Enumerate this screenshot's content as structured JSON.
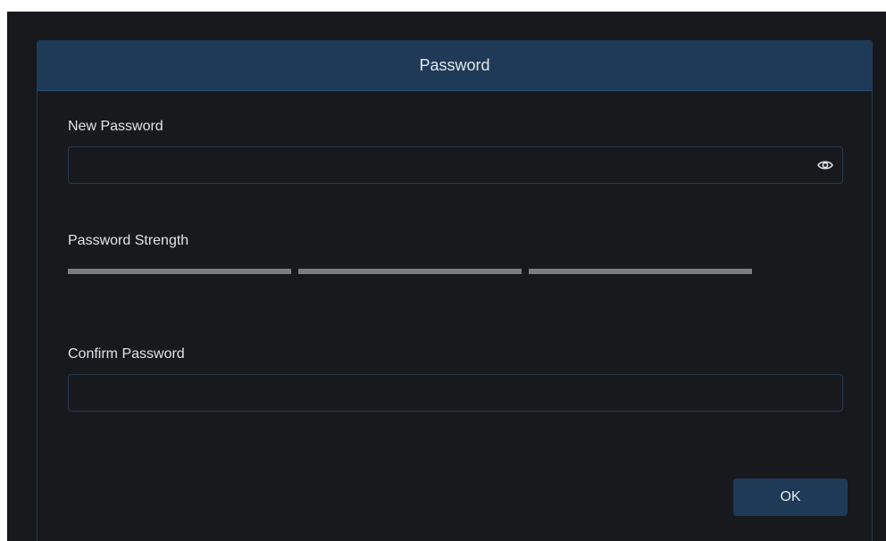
{
  "dialog": {
    "title": "Password",
    "new_password": {
      "label": "New Password",
      "value": "",
      "placeholder": ""
    },
    "strength": {
      "label": "Password Strength",
      "segments": 3,
      "level": 0
    },
    "confirm_password": {
      "label": "Confirm Password",
      "value": "",
      "placeholder": ""
    },
    "ok_label": "OK"
  },
  "icons": {
    "toggle_visibility": "eye-icon"
  },
  "colors": {
    "header_bg": "#1e3a57",
    "dialog_bg": "#17191d",
    "input_border": "#253a50",
    "strength_empty": "#7b7d80",
    "text": "#e1e4e8"
  }
}
